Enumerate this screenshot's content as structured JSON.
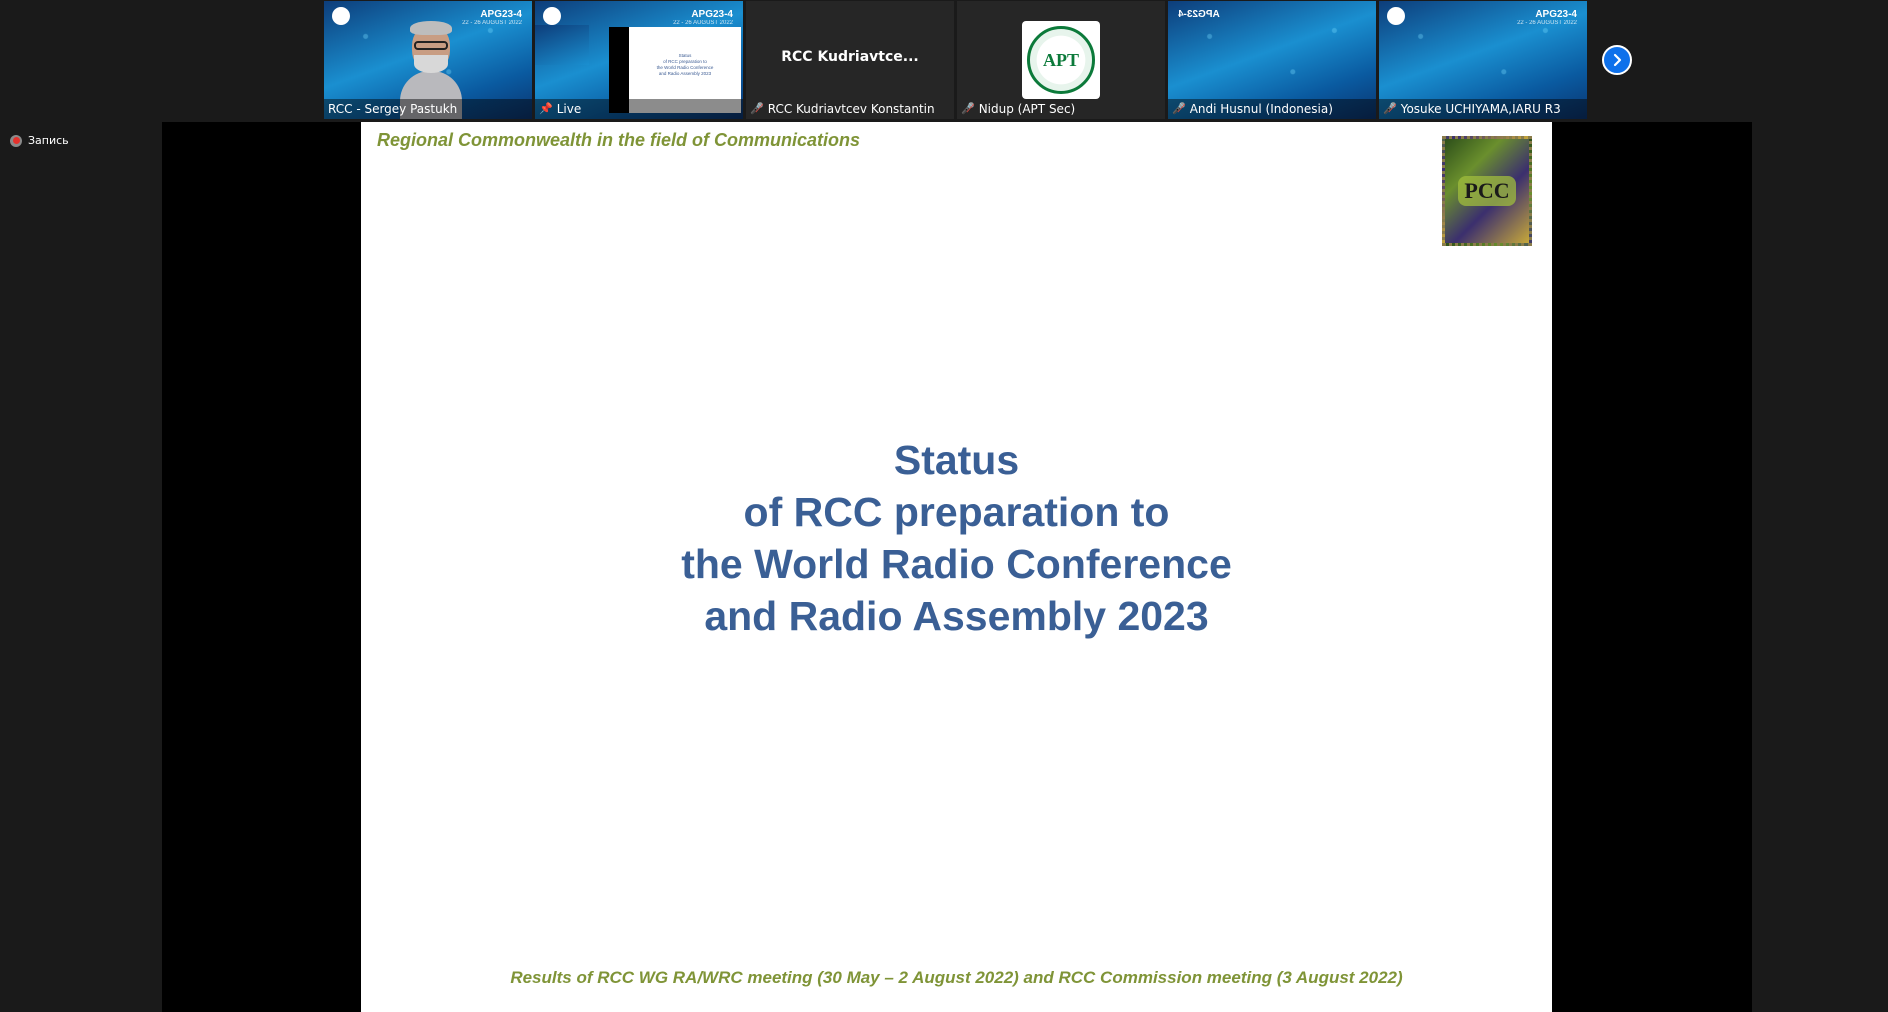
{
  "participants": [
    {
      "name": "RCC - Sergey Pastukh",
      "badge": "APG23-4",
      "badge_sub": "22 - 26 AUGUST 2022",
      "muted": false
    },
    {
      "name": "Live",
      "badge": "APG23-4",
      "badge_sub": "22 - 26 AUGUST 2022",
      "pinned": true,
      "preview_lines": [
        "Status",
        "of RCC preparation to",
        "the World Radio Conference",
        "and Radio Assembly 2023"
      ]
    },
    {
      "name": "RCC Kudriavtcev Konstantin",
      "display": "RCC  Kudriavtce...",
      "muted": true
    },
    {
      "name": "Nidup (APT Sec)",
      "logo": "APT",
      "muted": true
    },
    {
      "name": "Andi Husnul (Indonesia)",
      "badge": "APG23-4",
      "muted": true
    },
    {
      "name": "Yosuke UCHIYAMA,IARU R3",
      "badge": "APG23-4",
      "badge_sub": "22 - 26 AUGUST 2022",
      "muted": true
    }
  ],
  "recording": {
    "label": "Запись",
    "color": "#e5312c"
  },
  "slide": {
    "header": "Regional Commonwealth in the field of Communications",
    "logo": "PCC",
    "title_lines": [
      "Status",
      "of RCC preparation to",
      "the World Radio Conference",
      "and Radio Assembly 2023"
    ],
    "footer": "Results of RCC WG RA/WRC meeting (30 May – 2 August 2022) and RCC Commission meeting (3 August 2022)"
  },
  "colors": {
    "accent": "#0e71eb",
    "active_speaker": "#23d959",
    "title": "#3a5f95",
    "header": "#7f9437"
  }
}
